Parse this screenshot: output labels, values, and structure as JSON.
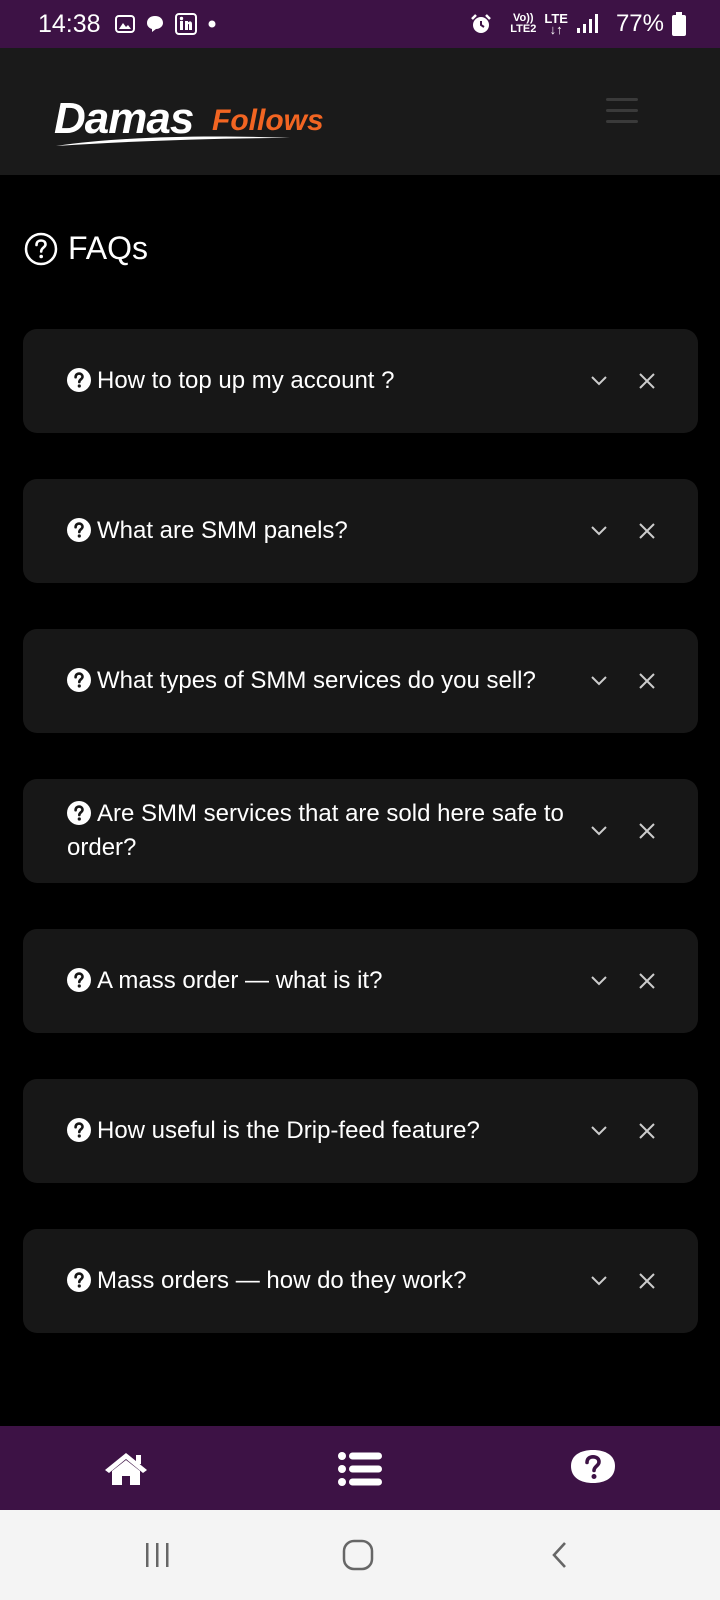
{
  "status_bar": {
    "time": "14:38",
    "network_top": "Vo))",
    "network_bottom": "LTE2",
    "lte": "LTE",
    "battery": "77%"
  },
  "header": {
    "logo_part1": "Damas",
    "logo_part2": "Follows"
  },
  "main": {
    "title": "FAQs",
    "faqs": [
      {
        "question": "How to top up my account ?"
      },
      {
        "question": "What are SMM panels?"
      },
      {
        "question": "What types of SMM services do you sell?"
      },
      {
        "question": "Are SMM services that are sold here safe to order?"
      },
      {
        "question": "A mass order — what is it?"
      },
      {
        "question": "How useful is the Drip-feed feature?"
      },
      {
        "question": "Mass orders — how do they work?"
      }
    ]
  },
  "bottom_nav": {
    "items": [
      {
        "icon": "home-icon"
      },
      {
        "icon": "list-icon"
      },
      {
        "icon": "question-icon"
      }
    ]
  },
  "colors": {
    "brand_purple": "#3d1245",
    "brand_orange": "#f26522",
    "card_bg": "#171717"
  }
}
